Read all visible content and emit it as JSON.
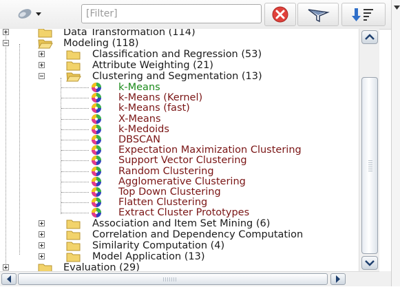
{
  "toolbar": {
    "tool_icon": "wrench-icon",
    "filter_placeholder": "[Filter]",
    "clear_icon": "clear-filter-icon",
    "filter_icon": "filter-icon",
    "sort_icon": "sort-icon"
  },
  "tree": {
    "rows": [
      {
        "label": "Data Transformation (114)",
        "kind": "folder",
        "expanded": false
      },
      {
        "label": "Modeling (118)",
        "kind": "folder",
        "expanded": true
      },
      {
        "label": "Classification and Regression (53)",
        "kind": "folder",
        "expanded": false
      },
      {
        "label": "Attribute Weighting (21)",
        "kind": "folder",
        "expanded": false
      },
      {
        "label": "Clustering and Segmentation (13)",
        "kind": "folder",
        "expanded": true
      },
      {
        "label": "k-Means",
        "kind": "operator",
        "selected": true
      },
      {
        "label": "k-Means (Kernel)",
        "kind": "operator"
      },
      {
        "label": "k-Means (fast)",
        "kind": "operator"
      },
      {
        "label": "X-Means",
        "kind": "operator"
      },
      {
        "label": "k-Medoids",
        "kind": "operator"
      },
      {
        "label": "DBSCAN",
        "kind": "operator"
      },
      {
        "label": "Expectation Maximization Clustering",
        "kind": "operator"
      },
      {
        "label": "Support Vector Clustering",
        "kind": "operator"
      },
      {
        "label": "Random Clustering",
        "kind": "operator"
      },
      {
        "label": "Agglomerative Clustering",
        "kind": "operator"
      },
      {
        "label": "Top Down Clustering",
        "kind": "operator"
      },
      {
        "label": "Flatten Clustering",
        "kind": "operator"
      },
      {
        "label": "Extract Cluster Prototypes",
        "kind": "operator"
      },
      {
        "label": "Association and Item Set Mining (6)",
        "kind": "folder",
        "expanded": false
      },
      {
        "label": "Correlation and Dependency Computation",
        "kind": "folder",
        "expanded": false
      },
      {
        "label": "Similarity Computation (4)",
        "kind": "folder",
        "expanded": false
      },
      {
        "label": "Model Application (13)",
        "kind": "folder",
        "expanded": false
      },
      {
        "label": "Evaluation (29)",
        "kind": "folder",
        "expanded": false
      }
    ]
  },
  "colors": {
    "selected_text": "#1a8a1a",
    "operator_text": "#7a1515",
    "folder_fill": "#f2d36b"
  }
}
